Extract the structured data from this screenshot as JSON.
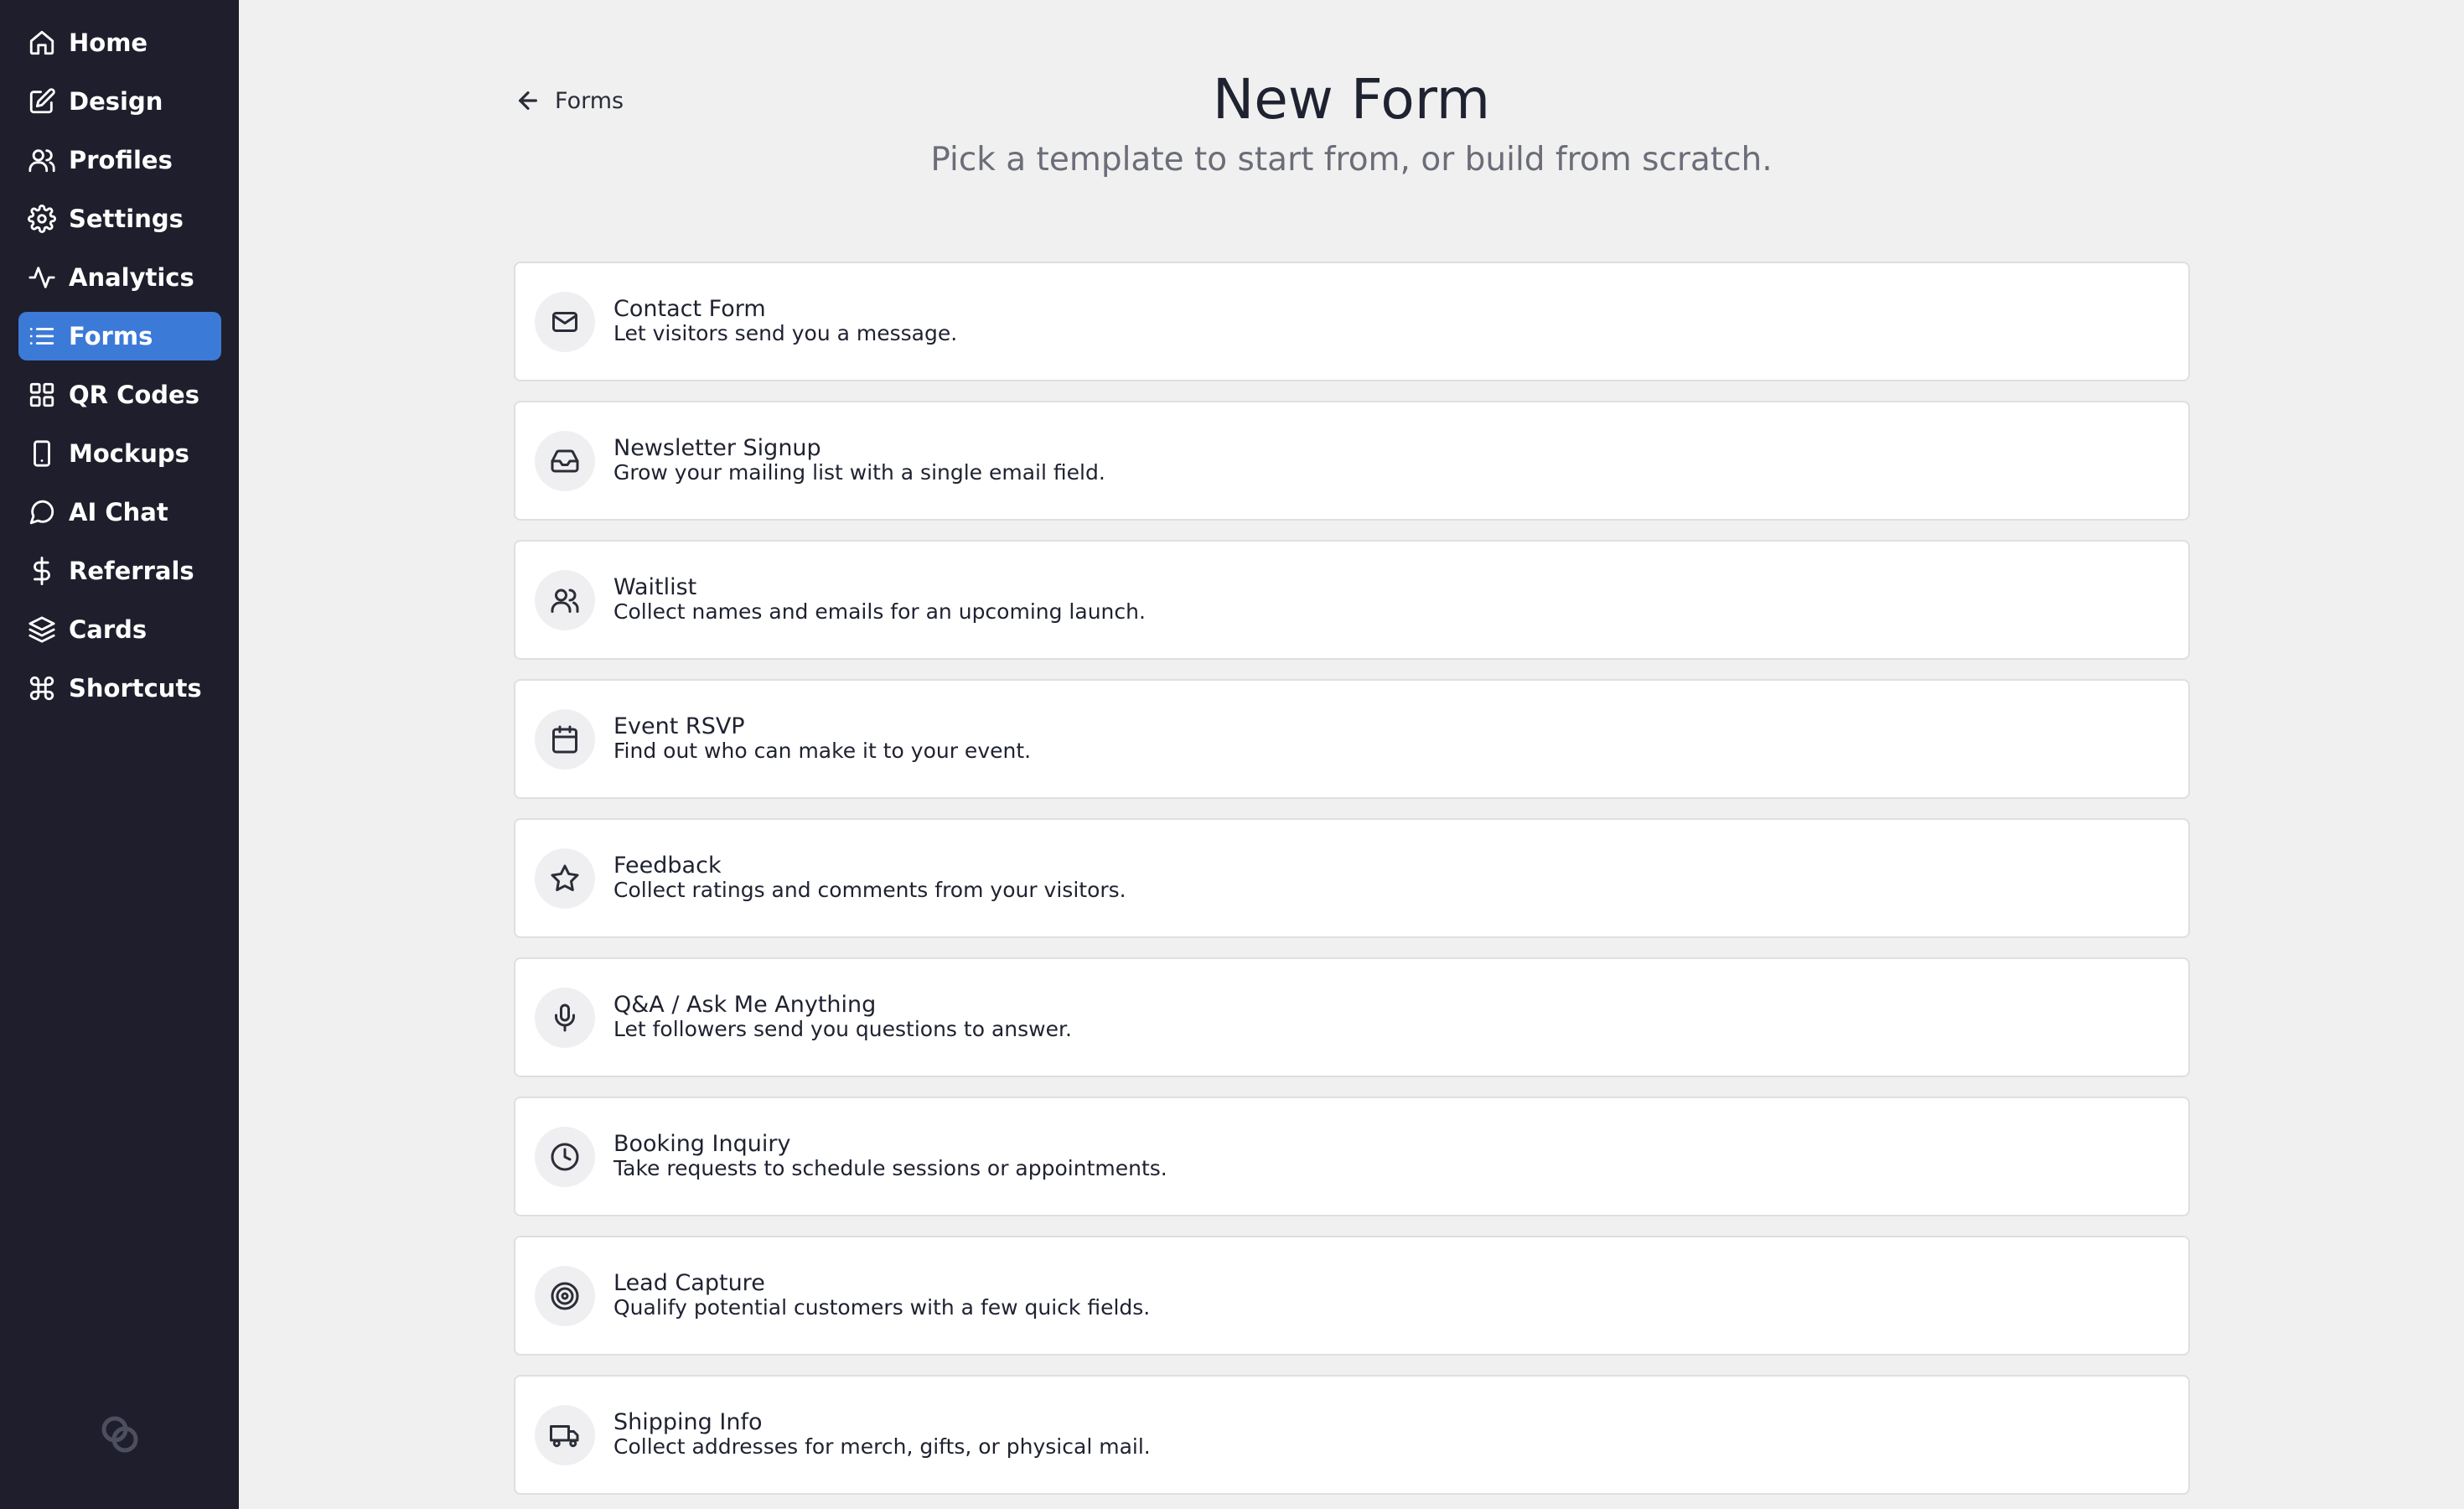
{
  "sidebar": {
    "items": [
      {
        "label": "Home",
        "icon": "home-icon",
        "active": false
      },
      {
        "label": "Design",
        "icon": "pencil-square-icon",
        "active": false
      },
      {
        "label": "Profiles",
        "icon": "users-icon",
        "active": false
      },
      {
        "label": "Settings",
        "icon": "gear-icon",
        "active": false
      },
      {
        "label": "Analytics",
        "icon": "activity-icon",
        "active": false
      },
      {
        "label": "Forms",
        "icon": "list-icon",
        "active": true
      },
      {
        "label": "QR Codes",
        "icon": "grid-icon",
        "active": false
      },
      {
        "label": "Mockups",
        "icon": "phone-icon",
        "active": false
      },
      {
        "label": "AI Chat",
        "icon": "chat-bubble-icon",
        "active": false
      },
      {
        "label": "Referrals",
        "icon": "dollar-icon",
        "active": false
      },
      {
        "label": "Cards",
        "icon": "layers-icon",
        "active": false
      },
      {
        "label": "Shortcuts",
        "icon": "command-icon",
        "active": false
      }
    ],
    "accent_color": "#3c7ad8",
    "background_color": "#1e1e2c",
    "footer_logo": "link-logo-icon"
  },
  "header": {
    "back_label": "Forms",
    "title": "New Form",
    "subtitle": "Pick a template to start from, or build from scratch."
  },
  "templates": [
    {
      "title": "Contact Form",
      "description": "Let visitors send you a message.",
      "icon": "mail-icon"
    },
    {
      "title": "Newsletter Signup",
      "description": "Grow your mailing list with a single email field.",
      "icon": "inbox-icon"
    },
    {
      "title": "Waitlist",
      "description": "Collect names and emails for an upcoming launch.",
      "icon": "users-icon"
    },
    {
      "title": "Event RSVP",
      "description": "Find out who can make it to your event.",
      "icon": "calendar-icon"
    },
    {
      "title": "Feedback",
      "description": "Collect ratings and comments from your visitors.",
      "icon": "star-icon"
    },
    {
      "title": "Q&A / Ask Me Anything",
      "description": "Let followers send you questions to answer.",
      "icon": "microphone-icon"
    },
    {
      "title": "Booking Inquiry",
      "description": "Take requests to schedule sessions or appointments.",
      "icon": "clock-icon"
    },
    {
      "title": "Lead Capture",
      "description": "Qualify potential customers with a few quick fields.",
      "icon": "target-icon"
    },
    {
      "title": "Shipping Info",
      "description": "Collect addresses for merch, gifts, or physical mail.",
      "icon": "truck-icon"
    }
  ]
}
